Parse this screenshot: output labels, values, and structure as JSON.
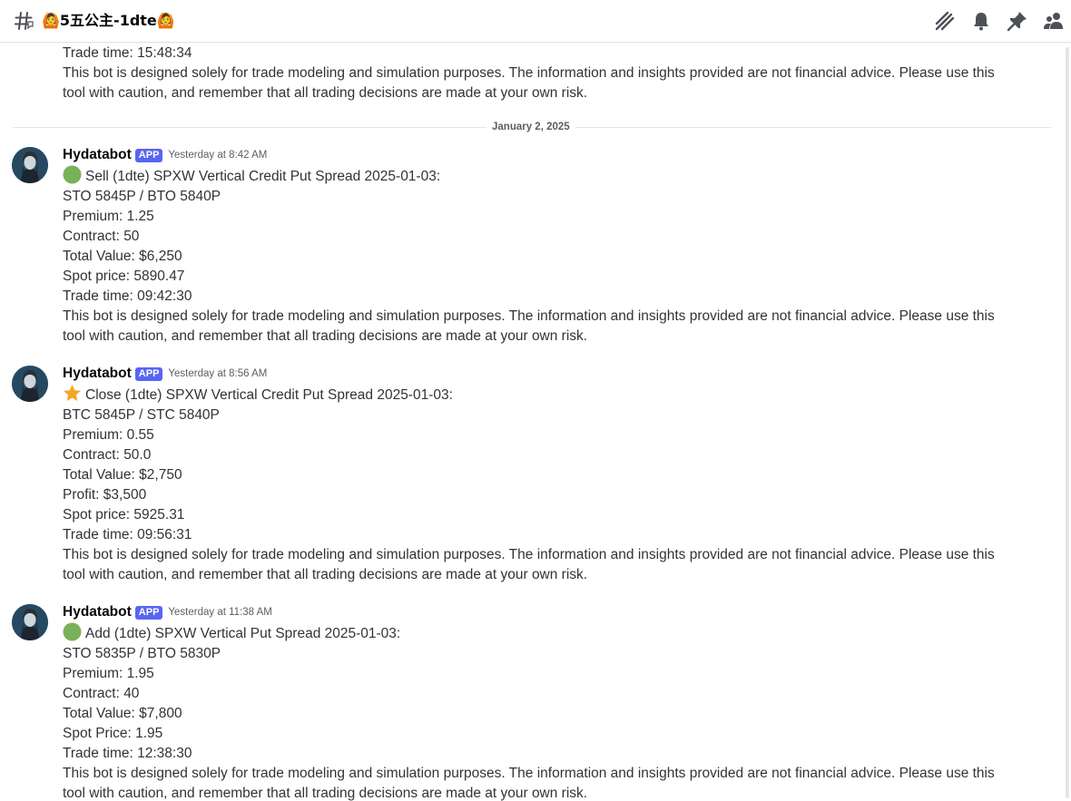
{
  "header": {
    "channel_name": "🙆5五公主-1dte🙆",
    "icons": [
      "threads-icon",
      "bell-icon",
      "pin-icon",
      "members-icon"
    ]
  },
  "colors": {
    "accent": "#5865f2",
    "green_circle": "#78b159",
    "star": "#f4a623"
  },
  "previous": {
    "trade_time": "Trade time: 15:48:34",
    "disclaimer": "This bot is designed solely for trade modeling and simulation purposes. The information and insights provided are not financial advice. Please use this tool with caution, and remember that all trading decisions are made at your own risk."
  },
  "divider": {
    "date": "January 2, 2025"
  },
  "messages": [
    {
      "username": "Hydatabot",
      "badge": "APP",
      "timestamp": "Yesterday at 8:42 AM",
      "emoji": "green-circle",
      "lines": [
        "Sell (1dte) SPXW Vertical Credit Put Spread 2025-01-03:",
        "STO 5845P / BTO 5840P",
        "Premium: 1.25",
        "Contract: 50",
        "Total Value: $6,250",
        "Spot price: 5890.47",
        "Trade time: 09:42:30"
      ],
      "disclaimer": "This bot is designed solely for trade modeling and simulation purposes. The information and insights provided are not financial advice. Please use this tool with caution, and remember that all trading decisions are made at your own risk."
    },
    {
      "username": "Hydatabot",
      "badge": "APP",
      "timestamp": "Yesterday at 8:56 AM",
      "emoji": "star",
      "lines": [
        "Close (1dte) SPXW Vertical Credit Put Spread 2025-01-03:",
        "BTC 5845P / STC 5840P",
        "Premium: 0.55",
        "Contract: 50.0",
        "Total Value: $2,750",
        "Profit: $3,500",
        "Spot price: 5925.31",
        "Trade time: 09:56:31"
      ],
      "disclaimer": "This bot is designed solely for trade modeling and simulation purposes. The information and insights provided are not financial advice. Please use this tool with caution, and remember that all trading decisions are made at your own risk."
    },
    {
      "username": "Hydatabot",
      "badge": "APP",
      "timestamp": "Yesterday at 11:38 AM",
      "emoji": "green-circle",
      "lines": [
        "Add (1dte) SPXW Vertical Put Spread 2025-01-03:",
        "STO 5835P / BTO 5830P",
        "Premium: 1.95",
        "Contract: 40",
        "Total Value: $7,800",
        "Spot Price: 1.95",
        "Trade time: 12:38:30"
      ],
      "disclaimer": "This bot is designed solely for trade modeling and simulation purposes. The information and insights provided are not financial advice. Please use this tool with caution, and remember that all trading decisions are made at your own risk."
    }
  ]
}
